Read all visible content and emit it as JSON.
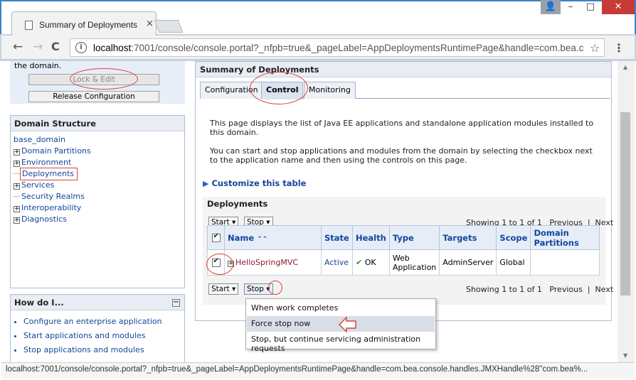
{
  "browser": {
    "tab_title": "Summary of Deployments",
    "close_glyph": "×",
    "url_host": "localhost",
    "url_rest": ":7001/console/console.portal?_nfpb=true&_pageLabel=AppDeploymentsRuntimePage&handle=com.bea.console.handles.JMXHandle%28",
    "status_text": "localhost:7001/console/console.portal?_nfpb=true&_pageLabel=AppDeploymentsRuntimePage&handle=com.bea.console.handles.JMXHandle%28\"com.bea%...",
    "nav": {
      "back": "←",
      "forward": "→",
      "reload": "C"
    },
    "info_glyph": "i",
    "star_glyph": "☆",
    "menu_glyph": "⋮",
    "window": {
      "user": "👤",
      "minimize": "–",
      "maximize": "□",
      "close": "✕"
    }
  },
  "change_center": {
    "text": "the domain.",
    "lock_edit": "Lock & Edit",
    "release": "Release Configuration"
  },
  "domain_structure": {
    "title": "Domain Structure",
    "root": "base_domain",
    "items": [
      {
        "label": "Domain Partitions",
        "expand": "+"
      },
      {
        "label": "Environment",
        "expand": "+"
      },
      {
        "label": "Deployments",
        "expand": ""
      },
      {
        "label": "Services",
        "expand": "+"
      },
      {
        "label": "Security Realms",
        "expand": ""
      },
      {
        "label": "Interoperability",
        "expand": "+"
      },
      {
        "label": "Diagnostics",
        "expand": "+"
      }
    ]
  },
  "how_do_i": {
    "title": "How do I...",
    "min_glyph": "−",
    "links": [
      "Configure an enterprise application",
      "Start applications and modules",
      "Stop applications and modules"
    ]
  },
  "main": {
    "title": "Summary of Deployments",
    "tabs": [
      "Configuration",
      "Control",
      "Monitoring"
    ],
    "active_tab": "Control",
    "intro1": "This page displays the list of Java EE applications and standalone application modules installed to this domain.",
    "intro2": "You can start and stop applications and modules from the domain by selecting the checkbox next to the application name and then using the controls on this page.",
    "customize": "Customize this table",
    "customize_glyph": "▶",
    "deployments_label": "Deployments",
    "start_btn": "Start",
    "stop_btn": "Stop",
    "caret": "▾",
    "pager": {
      "showing": "Showing 1 to 1 of 1",
      "previous": "Previous",
      "sep": "|",
      "next": "Next"
    },
    "columns": {
      "name": "Name",
      "sort_glyph": "⌃⌃",
      "state": "State",
      "health": "Health",
      "type": "Type",
      "targets": "Targets",
      "scope": "Scope",
      "partitions": "Domain Partitions"
    },
    "rows": [
      {
        "name": "HelloSpringMVC",
        "expand": "+",
        "state": "Active",
        "health_icon": "✔",
        "health": "OK",
        "type": "Web Application",
        "targets": "AdminServer",
        "scope": "Global",
        "partitions": ""
      }
    ],
    "stop_menu": [
      "When work completes",
      "Force stop now",
      "Stop, but continue servicing administration requests"
    ]
  },
  "colors": {
    "link": "#12469b",
    "highlight_oval": "#d9453a",
    "close_btn": "#c73a35"
  }
}
